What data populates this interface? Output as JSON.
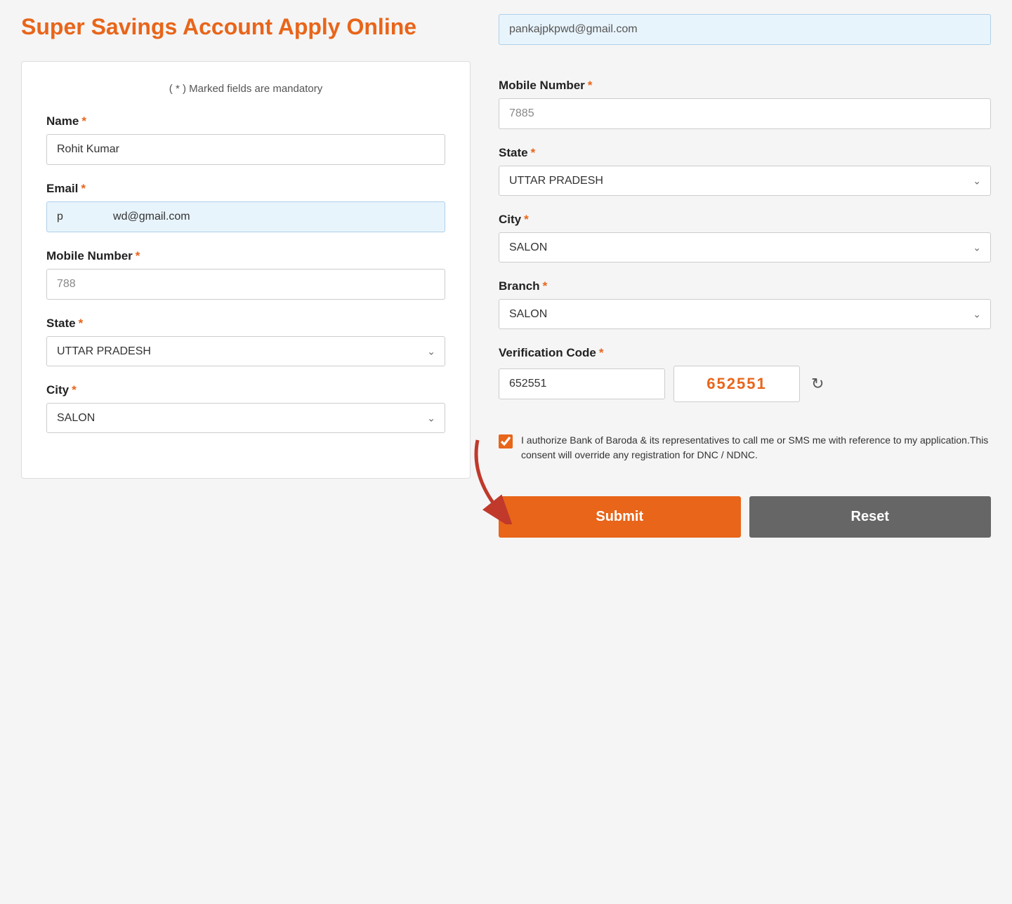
{
  "page": {
    "title": "Super Savings Account Apply Online"
  },
  "left_form": {
    "mandatory_note": "( * ) Marked fields are mandatory",
    "name_label": "Name",
    "name_value": "Rohit Kumar",
    "email_label": "Email",
    "email_value": "p                wd@gmail.com",
    "mobile_label": "Mobile Number",
    "mobile_value": "788",
    "state_label": "State",
    "state_value": "UTTAR PRADESH",
    "city_label": "City",
    "city_value": "SALON",
    "required_star": "*"
  },
  "right_form": {
    "email_display": "pankajpkpwd@gmail.com",
    "mobile_label": "Mobile Number",
    "mobile_value": "7885",
    "state_label": "State",
    "state_value": "UTTAR PRADESH",
    "city_label": "City",
    "city_value": "SALON",
    "branch_label": "Branch",
    "branch_value": "SALON",
    "verification_label": "Verification Code",
    "verification_input_value": "652551",
    "verification_code": "652551",
    "consent_text": "I authorize Bank of Baroda & its representatives to call me or SMS me with reference to my application.This consent will override any registration for DNC / NDNC.",
    "submit_label": "Submit",
    "reset_label": "Reset",
    "required_star": "*"
  },
  "icons": {
    "chevron": "⌄",
    "refresh": "↻",
    "checkmark": "✓"
  }
}
